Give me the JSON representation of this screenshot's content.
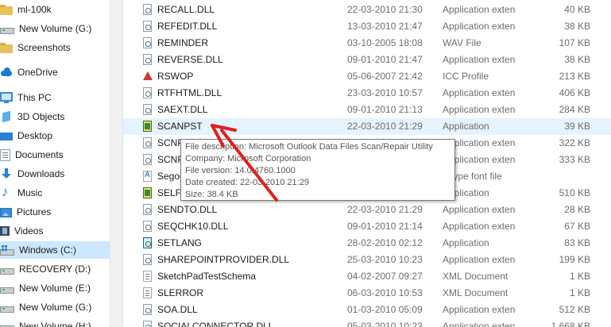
{
  "nav": {
    "items": [
      {
        "label": "ml-100k",
        "icon": "folder-icon"
      },
      {
        "label": "New Volume (G:)",
        "icon": "drive-icon"
      },
      {
        "label": "Screenshots",
        "icon": "folder-icon"
      },
      {
        "label": "OneDrive",
        "icon": "cloud-icon"
      },
      {
        "label": "This PC",
        "icon": "computer-icon"
      },
      {
        "label": "3D Objects",
        "icon": "3d-objects-icon"
      },
      {
        "label": "Desktop",
        "icon": "desktop-icon"
      },
      {
        "label": "Documents",
        "icon": "documents-icon"
      },
      {
        "label": "Downloads",
        "icon": "downloads-icon"
      },
      {
        "label": "Music",
        "icon": "music-icon"
      },
      {
        "label": "Pictures",
        "icon": "pictures-icon"
      },
      {
        "label": "Videos",
        "icon": "videos-icon"
      },
      {
        "label": "Windows (C:)",
        "icon": "windows-drive-icon",
        "selected": true
      },
      {
        "label": "RECOVERY (D:)",
        "icon": "drive-icon"
      },
      {
        "label": "New Volume (E:)",
        "icon": "drive-icon"
      },
      {
        "label": "New Volume (G:)",
        "icon": "drive-icon"
      },
      {
        "label": "New Volume (H:)",
        "icon": "drive-icon"
      }
    ]
  },
  "files": [
    {
      "name": "RECALL.DLL",
      "date": "22-03-2010 21:30",
      "type": "Application extens...",
      "size": "40 KB",
      "icon": "dll-file-icon"
    },
    {
      "name": "REFEDIT.DLL",
      "date": "13-03-2010 21:47",
      "type": "Application extens...",
      "size": "38 KB",
      "icon": "dll-file-icon"
    },
    {
      "name": "REMINDER",
      "date": "03-10-2005 18:08",
      "type": "WAV File",
      "size": "107 KB",
      "icon": "wav-file-icon"
    },
    {
      "name": "REVERSE.DLL",
      "date": "09-01-2010 21:47",
      "type": "Application extens...",
      "size": "38 KB",
      "icon": "dll-file-icon"
    },
    {
      "name": "RSWOP",
      "date": "05-06-2007 21:42",
      "type": "ICC Profile",
      "size": "213 KB",
      "icon": "icc-profile-icon"
    },
    {
      "name": "RTFHTML.DLL",
      "date": "23-03-2010 10:57",
      "type": "Application extens...",
      "size": "406 KB",
      "icon": "dll-file-icon"
    },
    {
      "name": "SAEXT.DLL",
      "date": "09-01-2010 21:13",
      "type": "Application extens...",
      "size": "284 KB",
      "icon": "dll-file-icon"
    },
    {
      "name": "SCANPST",
      "date": "22-03-2010 21:29",
      "type": "Application",
      "size": "39 KB",
      "icon": "application-icon",
      "highlighted": true
    },
    {
      "name": "SCNP",
      "date": "",
      "type": "Application extens...",
      "size": "322 KB",
      "icon": "dll-file-icon"
    },
    {
      "name": "SCNP",
      "date": "",
      "type": "Application extens...",
      "size": "333 KB",
      "icon": "dll-file-icon"
    },
    {
      "name": "Segoe",
      "date": "",
      "type": "eType font file",
      "size": "",
      "icon": "font-file-icon"
    },
    {
      "name": "SELFC",
      "date": "",
      "type": "Application",
      "size": "510 KB",
      "icon": "application-icon"
    },
    {
      "name": "SENDTO.DLL",
      "date": "22-03-2010 21:29",
      "type": "Application extens...",
      "size": "28 KB",
      "icon": "dll-file-icon"
    },
    {
      "name": "SEQCHK10.DLL",
      "date": "09-01-2010 21:14",
      "type": "Application extens...",
      "size": "67 KB",
      "icon": "dll-file-icon"
    },
    {
      "name": "SETLANG",
      "date": "28-02-2010 02:12",
      "type": "Application",
      "size": "83 KB",
      "icon": "setup-app-icon"
    },
    {
      "name": "SHAREPOINTPROVIDER.DLL",
      "date": "25-03-2010 10:23",
      "type": "Application extens...",
      "size": "199 KB",
      "icon": "dll-file-icon"
    },
    {
      "name": "SketchPadTestSchema",
      "date": "04-02-2007 09:27",
      "type": "XML Document",
      "size": "1 KB",
      "icon": "xml-file-icon"
    },
    {
      "name": "SLERROR",
      "date": "06-03-2010 10:53",
      "type": "XML Document",
      "size": "1 KB",
      "icon": "xml-file-icon"
    },
    {
      "name": "SOA.DLL",
      "date": "01-03-2010 05:09",
      "type": "Application extens...",
      "size": "512 KB",
      "icon": "dll-file-icon"
    },
    {
      "name": "SOCIALCONNECTOR.DLL",
      "date": "05-03-2010 10:23",
      "type": "Application extens...",
      "size": "1,668 KB",
      "icon": "dll-file-icon"
    }
  ],
  "tooltip": {
    "description": "File description: Microsoft Outlook Data Files Scan/Repair Utility",
    "company": "Company: Microsoft Corporation",
    "version": "File version: 14.0.4760.1000",
    "created": "Date created: 22-03-2010 21:29",
    "size": "Size: 38.4 KB"
  },
  "colors": {
    "selection": "#cce8ff",
    "hover_row": "#e5f3ff",
    "arrow": "#e02020"
  }
}
